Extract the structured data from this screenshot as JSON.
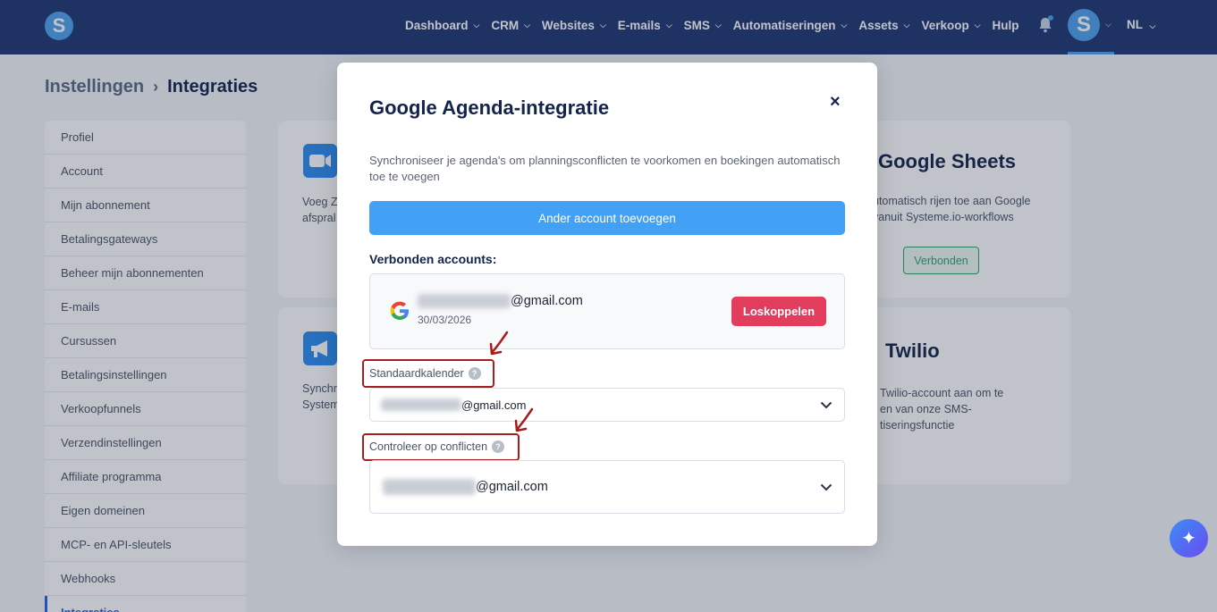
{
  "nav": {
    "logo": "S",
    "items": [
      {
        "label": "Dashboard",
        "has_menu": true
      },
      {
        "label": "CRM",
        "has_menu": true
      },
      {
        "label": "Websites",
        "has_menu": true
      },
      {
        "label": "E-mails",
        "has_menu": true
      },
      {
        "label": "SMS",
        "has_menu": true
      },
      {
        "label": "Automatiseringen",
        "has_menu": true
      },
      {
        "label": "Assets",
        "has_menu": true
      },
      {
        "label": "Verkoop",
        "has_menu": true
      },
      {
        "label": "Hulp",
        "has_menu": false
      }
    ],
    "avatar_letter": "S",
    "language": "NL",
    "icons": {
      "bell": "bell-icon",
      "chevron": "chevron-down-icon"
    }
  },
  "breadcrumb": {
    "parent": "Instellingen",
    "separator": "›",
    "current": "Integraties"
  },
  "sidebar": {
    "items": [
      {
        "label": "Profiel"
      },
      {
        "label": "Account"
      },
      {
        "label": "Mijn abonnement"
      },
      {
        "label": "Betalingsgateways"
      },
      {
        "label": "Beheer mijn abonnementen"
      },
      {
        "label": "E-mails"
      },
      {
        "label": "Cursussen"
      },
      {
        "label": "Betalingsinstellingen"
      },
      {
        "label": "Verkoopfunnels"
      },
      {
        "label": "Verzendinstellingen"
      },
      {
        "label": "Affiliate programma"
      },
      {
        "label": "Eigen domeinen"
      },
      {
        "label": "MCP- en API-sleutels"
      },
      {
        "label": "Webhooks"
      },
      {
        "label": "Integraties"
      }
    ],
    "active_index": 14
  },
  "cards": {
    "zoom": {
      "text_line1": "Voeg Z",
      "text_line2": "afspral"
    },
    "announce": {
      "text_line1": "Synchr",
      "text_line2": "System"
    },
    "sheets": {
      "title": "Google Sheets",
      "text_line1": "utomatisch rijen toe aan Google",
      "text_line2": "vanuit Systeme.io-workflows",
      "button": "Verbonden"
    },
    "twilio": {
      "title": "Twilio",
      "text_line1": "Twilio-account aan om te",
      "text_line2": "en van onze SMS-",
      "text_line3": "tiseringsfunctie"
    }
  },
  "modal": {
    "title": "Google Agenda-integratie",
    "close": "×",
    "description": "Synchroniseer je agenda's om planningsconflicten te voorkomen en boekingen automatisch toe te voegen",
    "add_account_button": "Ander account toevoegen",
    "connected_label": "Verbonden accounts:",
    "account": {
      "email_suffix": "@gmail.com",
      "date": "30/03/2026",
      "disconnect_button": "Loskoppelen"
    },
    "default_calendar": {
      "label": "Standaardkalender",
      "help": "?",
      "value_suffix": "@gmail.com"
    },
    "check_conflicts": {
      "label": "Controleer op conflicten",
      "help": "?",
      "value_suffix": "@gmail.com"
    },
    "annotation_color": "#a51d1d",
    "primary_color": "#42a0f5",
    "danger_color": "#e23d5d"
  },
  "fab": {
    "icon": "sparkle-icon",
    "glyph": "✦"
  }
}
